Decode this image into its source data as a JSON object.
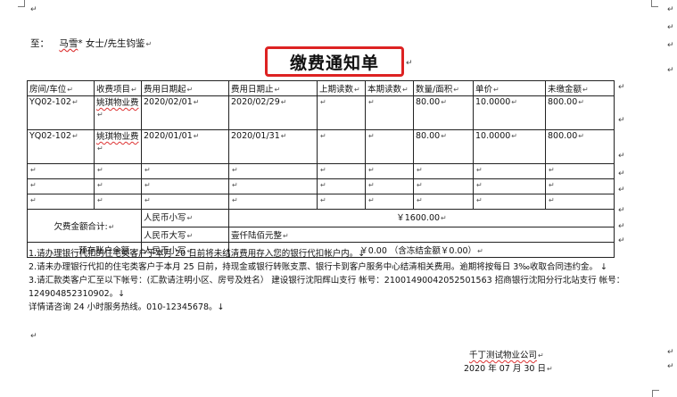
{
  "marks": {
    "pilcrow": "↵"
  },
  "recipient": {
    "prefix": "至：",
    "name": "马雪",
    "suffix": "* 女士/先生钧鉴"
  },
  "title": "缴费通知单",
  "table": {
    "headers": [
      "房间/车位",
      "收费项目",
      "费用日期起",
      "费用日期止",
      "上期读数",
      "本期读数",
      "数量/面积",
      "单价",
      "未缴金额"
    ],
    "rows": [
      [
        "YQ02-102",
        "姚琪物业费",
        "2020/02/01",
        "2020/02/29",
        "",
        "",
        "80.00",
        "10.0000",
        "800.00"
      ],
      [
        "YQ02-102",
        "姚琪物业费",
        "2020/01/01",
        "2020/01/31",
        "",
        "",
        "80.00",
        "10.0000",
        "800.00"
      ]
    ],
    "empty_rows": 3,
    "arrears_label": "欠费金额合计:",
    "rmb_lower_label": "人民币小写",
    "rmb_upper_label": "人民币大写",
    "arrears_amount": "￥1600.00",
    "arrears_upper": "壹仟陆佰元整",
    "prepaid_label": "预存账户余额:",
    "prepaid_rmb_label": "人民币小写",
    "prepaid_amount": "￥0.00 （含冻结金额￥0.00）"
  },
  "notes": [
    "1.请办理银行代扣的住宅类客户于本月 20 日前将未结清费用存入您的银行代扣帐户内。↓",
    "2.请未办理银行代扣的住宅类客户于本月 25 日前，持现金或银行转账支票、银行卡到客户服务中心结清相关费用。逾期将按每日 3‰收取合同违约金。 ↓",
    "3.请汇款类客户汇至以下帐号：(汇款请注明小区、房号及姓名）  建设银行沈阳辉山支行 帐号：21001490042052501563 招商银行沈阳分行北站支行 帐号：124904852310902。↓",
    "详情请咨询 24 小时服务热线。010-12345678。↓"
  ],
  "signature": {
    "company": "千丁测试物业公司",
    "date": "2020 年 07 月 30 日"
  }
}
